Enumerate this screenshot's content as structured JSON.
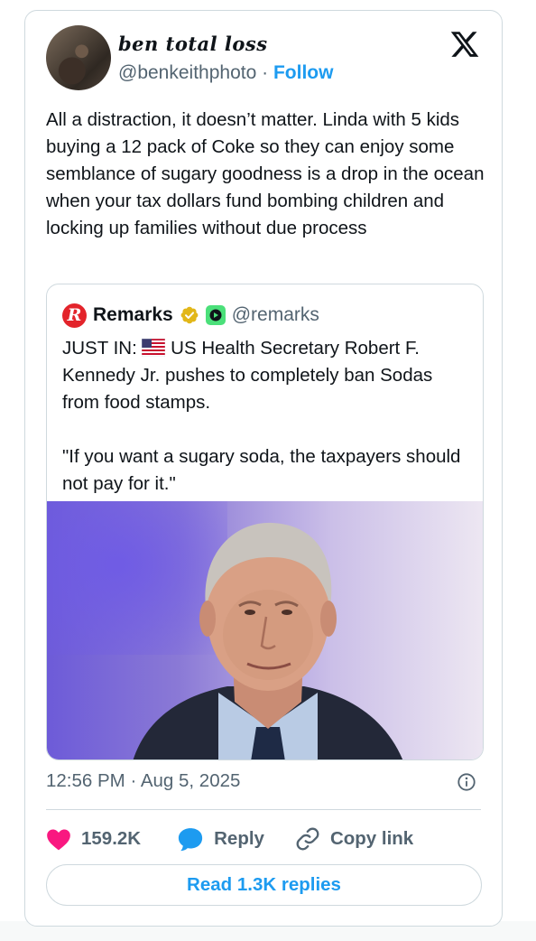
{
  "tweet": {
    "display_name": "ben total loss",
    "handle": "@benkeithphoto",
    "separator": "·",
    "follow_label": "Follow",
    "text": "All a distraction, it doesn’t matter. Linda with 5 kids buying a 12 pack of Coke so they can enjoy some semblance of sugary goodness is a drop in the ocean when your tax dollars fund bombing children and locking up families without due process",
    "timestamp": "12:56 PM · Aug 5, 2025"
  },
  "quote": {
    "logo_letter": "R",
    "name": "Remarks",
    "handle": "@remarks",
    "text_prefix": "JUST IN: ",
    "text_body": "US Health Secretary Robert F. Kennedy Jr. pushes to completely ban Sodas from food stamps.\n\n\"If you want a sugary soda, the taxpayers should not pay for it.\""
  },
  "actions": {
    "likes": "159.2K",
    "reply_label": "Reply",
    "copy_label": "Copy link"
  },
  "read_replies_label": "Read 1.3K replies",
  "icons": [
    "x-logo-icon",
    "verified-badge-icon",
    "affiliate-icon",
    "us-flag-icon",
    "info-icon",
    "heart-icon",
    "reply-bubble-icon",
    "link-icon"
  ],
  "colors": {
    "accent": "#1d9bf0",
    "like": "#f91880",
    "gold_badge": "#e2b719",
    "remarks_red": "#e3242b",
    "secondary_text": "#536471",
    "border": "#cfd9de"
  }
}
